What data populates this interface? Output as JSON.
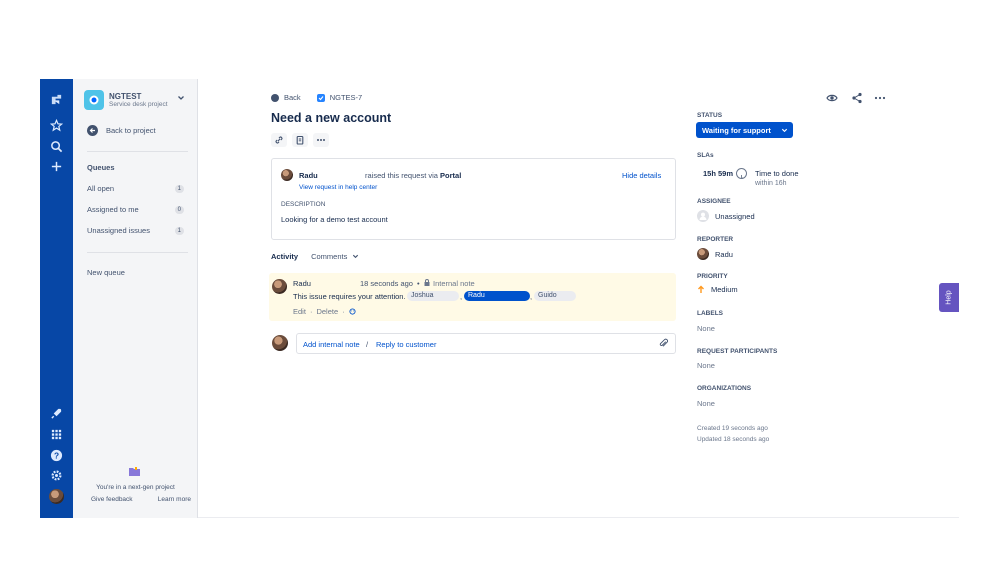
{
  "project": {
    "name": "NGTEST",
    "type": "Service desk project",
    "back_label": "Back to project",
    "queues_heading": "Queues",
    "queues": [
      {
        "label": "All open",
        "count": "1"
      },
      {
        "label": "Assigned to me",
        "count": "0"
      },
      {
        "label": "Unassigned issues",
        "count": "1"
      }
    ],
    "new_queue": "New queue",
    "nextgen_text": "You're in a next-gen project",
    "give_feedback": "Give feedback",
    "learn_more": "Learn more"
  },
  "breadcrumb": {
    "back": "Back",
    "issue_key": "NGTES-7"
  },
  "issue": {
    "title": "Need a new account",
    "reporter_name": "Radu",
    "raised_prefix": "raised this request via",
    "raised_channel": "Portal",
    "view_request_link": "View request in help center",
    "hide_details": "Hide details",
    "description_label": "DESCRIPTION",
    "description": "Looking for a demo test account"
  },
  "activity": {
    "label": "Activity",
    "filter": "Comments"
  },
  "note": {
    "author": "Radu",
    "time": "18 seconds ago",
    "dot": "•",
    "visibility": "Internal note",
    "text": "This issue requires your attention.",
    "mentions": [
      "Joshua",
      "Radu",
      "Guido"
    ],
    "sep": ",",
    "edit": "Edit",
    "delete": "Delete",
    "mid_dot": "·"
  },
  "reply": {
    "add_internal": "Add internal note",
    "slash": "/",
    "reply_customer": "Reply to customer"
  },
  "side": {
    "status_label": "STATUS",
    "status_value": "Waiting for support",
    "slas_label": "SLAs",
    "sla_time": "15h 59m",
    "sla_name": "Time to done",
    "sla_target": "within 16h",
    "assignee_label": "ASSIGNEE",
    "assignee_value": "Unassigned",
    "reporter_label": "REPORTER",
    "reporter_value": "Radu",
    "priority_label": "PRIORITY",
    "priority_value": "Medium",
    "labels_label": "LABELS",
    "labels_value": "None",
    "participants_label": "REQUEST PARTICIPANTS",
    "participants_value": "None",
    "orgs_label": "ORGANIZATIONS",
    "orgs_value": "None",
    "created": "Created 19 seconds ago",
    "updated": "Updated 18 seconds ago"
  },
  "help_tab": "Help",
  "colors": {
    "nav_blue": "#0747a6",
    "primary": "#0052cc",
    "internal_note_bg": "#fffae6",
    "help_purple": "#6554c0",
    "priority_orange": "#ff991f"
  },
  "icons": [
    "jira-logo-icon",
    "star-icon",
    "search-icon",
    "plus-icon",
    "rocket-icon",
    "app-switcher-icon",
    "help-icon",
    "settings-icon",
    "back-arrow-icon",
    "chevron-down-icon",
    "link-icon",
    "clipboard-icon",
    "more-icon",
    "watch-icon",
    "share-icon",
    "lock-icon",
    "clock-icon",
    "paperclip-icon",
    "arrow-up-icon",
    "add-reaction-icon"
  ]
}
